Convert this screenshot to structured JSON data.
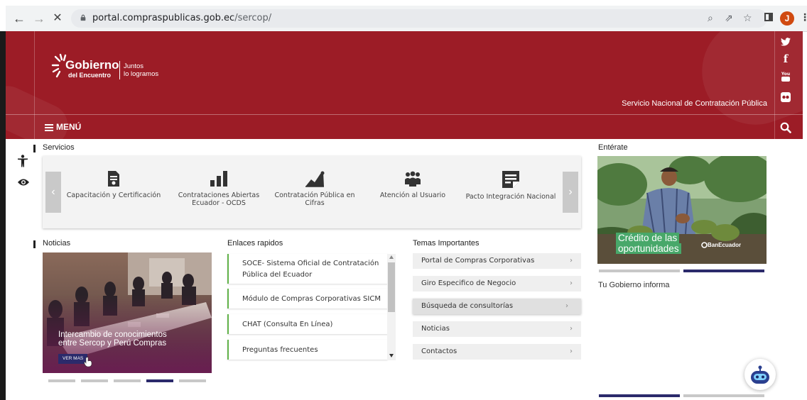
{
  "browser": {
    "url_host": "portal.compraspublicas.gob.ec",
    "url_path": "/sercop/",
    "profile_initial": "J"
  },
  "header": {
    "logo_brand_line1": "Gobierno",
    "logo_brand_line2": "del Encuentro",
    "logo_tag_line1": "Juntos",
    "logo_tag_line2": "lo logramos",
    "agency_name": "Servicio Nacional de Contratación Pública",
    "menu_label": "MENÚ",
    "social_icons": [
      "twitter-icon",
      "facebook-icon",
      "youtube-icon",
      "flickr-icon"
    ]
  },
  "colors": {
    "brand_red": "#9c1c26",
    "navy": "#2b2a6b",
    "link_green": "#62b34a"
  },
  "servicios": {
    "title": "Servicios",
    "items": [
      {
        "icon": "certificate-icon",
        "label": "Capacitación y Certificación"
      },
      {
        "icon": "bar-chart-icon",
        "label": "Contrataciones Abiertas Ecuador - OCDS"
      },
      {
        "icon": "area-chart-icon",
        "label": "Contratación Pública en Cifras"
      },
      {
        "icon": "people-group-icon",
        "label": "Atención al Usuario"
      },
      {
        "icon": "document-icon",
        "label": "Pacto Integración Nacional"
      }
    ]
  },
  "noticias": {
    "title": "Noticias",
    "caption_line1": "Intercambio de conocimientos",
    "caption_line2": "entre Sercop y Perú Compras",
    "more_label": "VER MAS"
  },
  "enlaces": {
    "title": "Enlaces rapidos",
    "items": [
      {
        "line1": "SOCE- Sistema Oficial de Contratación",
        "line2": "Pública del Ecuador"
      },
      {
        "line1": "Módulo de Compras Corporativas SICM",
        "line2": ""
      },
      {
        "line1": "CHAT (Consulta En Línea)",
        "line2": ""
      },
      {
        "line1": "Preguntas frecuentes",
        "line2": ""
      }
    ]
  },
  "temas": {
    "title": "Temas Importantes",
    "items": [
      {
        "label": "Portal de Compras Corporativas"
      },
      {
        "label": "Giro Especifico de Negocio"
      },
      {
        "label": "Búsqueda de consultorías"
      },
      {
        "label": "Noticias"
      },
      {
        "label": "Contactos"
      }
    ]
  },
  "enterate": {
    "title": "Entérate",
    "caption_line1": "Crédito de las",
    "caption_line2": "oportunidades",
    "brand": "BanEcuador"
  },
  "gobierno_informa": {
    "title": "Tu Gobierno informa"
  },
  "chevron": "›"
}
